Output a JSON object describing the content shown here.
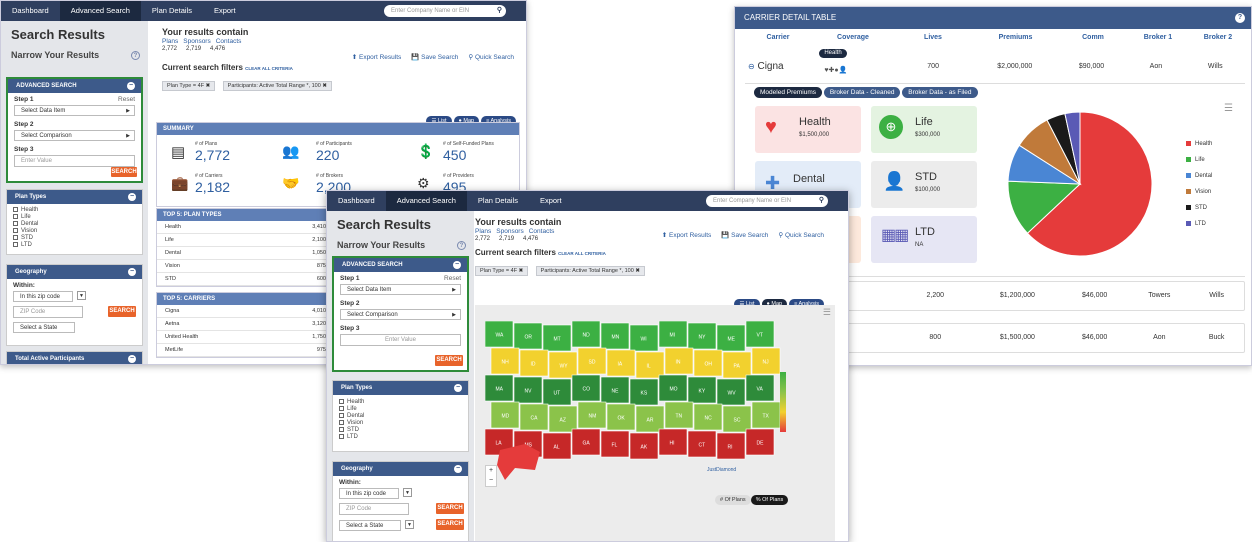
{
  "nav": {
    "items": [
      "Dashboard",
      "Advanced Search",
      "Plan Details",
      "Export"
    ],
    "search_placeholder": "Enter Company Name or EIN"
  },
  "sidebar": {
    "title": "Search Results",
    "narrow": "Narrow Your Results",
    "help": "?",
    "advanced": {
      "title": "ADVANCED SEARCH",
      "step1": "Step 1",
      "reset": "Reset",
      "select_data": "Select Data Item",
      "step2": "Step 2",
      "select_comparison": "Select Comparison",
      "step3": "Step 3",
      "enter_value": "Enter Value",
      "search": "SEARCH"
    },
    "plan_types": {
      "title": "Plan Types",
      "items": [
        "Health",
        "Life",
        "Dental",
        "Vision",
        "STD",
        "LTD"
      ]
    },
    "geography": {
      "title": "Geography",
      "within": "Within:",
      "zip_mode": "In this zip code",
      "zip_placeholder": "ZIP Code",
      "state_placeholder": "Select a State",
      "search": "SEARCH"
    },
    "total_active": "Total Active Participants"
  },
  "results": {
    "heading": "Your results contain",
    "labels": [
      "Plans",
      "Sponsors",
      "Contacts"
    ],
    "values": [
      "2,772",
      "2,719",
      "4,476"
    ],
    "export": "Export Results",
    "save": "Save Search",
    "quick": "Quick Search",
    "filters_title": "Current search filters",
    "clear": "CLEAR ALL CRITERIA",
    "filter1": "Plan Type = 4F",
    "filter2": "Participants: Active Total Range *, 100",
    "filter_x": "✖",
    "views": [
      "List",
      "Map",
      "Analysis"
    ]
  },
  "summary": {
    "title": "SUMMARY",
    "stats": [
      {
        "label": "# of Plans",
        "value": "2,772"
      },
      {
        "label": "# of Participants",
        "value": "220"
      },
      {
        "label": "# of Self-Funded Plans",
        "value": "450"
      },
      {
        "label": "# of Carriers",
        "value": "2,182"
      },
      {
        "label": "# of Brokers",
        "value": "2,200"
      },
      {
        "label": "# of Providers",
        "value": "495"
      }
    ]
  },
  "top_plan_types": {
    "title": "TOP 5: PLAN TYPES",
    "rows": [
      [
        "Health",
        "3,410"
      ],
      [
        "Life",
        "2,100"
      ],
      [
        "Dental",
        "1,050"
      ],
      [
        "Vision",
        "875"
      ],
      [
        "STD",
        "600"
      ]
    ]
  },
  "top_carriers": {
    "title": "TOP 5: CARRIERS",
    "rows": [
      [
        "Cigna",
        "4,010"
      ],
      [
        "Aetna",
        "3,120"
      ],
      [
        "United Health",
        "1,750"
      ],
      [
        "MetLife",
        "975"
      ]
    ]
  },
  "map": {
    "states": [
      "WA",
      "OR",
      "MT",
      "ND",
      "MN",
      "WI",
      "MI",
      "NY",
      "ME",
      "VT",
      "NH",
      "ID",
      "WY",
      "SD",
      "IA",
      "IL",
      "IN",
      "OH",
      "PA",
      "NJ",
      "MA",
      "NV",
      "UT",
      "CO",
      "NE",
      "KS",
      "MO",
      "KY",
      "WV",
      "VA",
      "MD",
      "CA",
      "AZ",
      "NM",
      "OK",
      "AR",
      "TN",
      "NC",
      "SC",
      "TX",
      "LA",
      "MS",
      "AL",
      "GA",
      "FL",
      "AK",
      "HI",
      "CT",
      "RI",
      "DE"
    ],
    "zoom_in": "+",
    "zoom_out": "−",
    "toggle": [
      "# Of Plans",
      "% Of Plans"
    ],
    "logo": "JustDiamond"
  },
  "carrier_table": {
    "title": "CARRIER DETAIL TABLE",
    "help": "?",
    "columns": [
      "Carrier",
      "Coverage",
      "Lives",
      "Premiums",
      "Comm",
      "Broker 1",
      "Broker 2"
    ],
    "row1": {
      "carrier": "Cigna",
      "tooltip": "Health",
      "lives": "700",
      "premiums": "$2,000,000",
      "comm": "$90,000",
      "broker1": "Aon",
      "broker2": "Wills"
    },
    "tabs": [
      "Modeled Premiums",
      "Broker Data - Cleaned",
      "Broker Data - as Filed"
    ],
    "tiles": [
      {
        "name": "Health",
        "value": "$1,500,000"
      },
      {
        "name": "Life",
        "value": "$300,000"
      },
      {
        "name": "Dental",
        "value": ""
      },
      {
        "name": "STD",
        "value": "$100,000"
      },
      {
        "name": "LTD",
        "value": "NA"
      }
    ],
    "rows": [
      {
        "lives": "2,200",
        "premiums": "$1,200,000",
        "comm": "$46,000",
        "broker1": "Towers",
        "broker2": "Wills"
      },
      {
        "lives": "800",
        "premiums": "$1,500,000",
        "comm": "$46,000",
        "broker1": "Aon",
        "broker2": "Buck"
      }
    ],
    "legend": [
      "Health",
      "Life",
      "Dental",
      "Vision",
      "STD",
      "LTD"
    ],
    "colors": {
      "Health": "#e53b3b",
      "Life": "#3cb043",
      "Dental": "#4a86d4",
      "Vision": "#c07a3a",
      "STD": "#1a1a1a",
      "LTD": "#5a5ab5"
    },
    "pie": [
      {
        "name": "Health",
        "value": 1500000
      },
      {
        "name": "Life",
        "value": 300000
      },
      {
        "name": "Dental",
        "value": 200000
      },
      {
        "name": "Vision",
        "value": 200000
      },
      {
        "name": "STD",
        "value": 100000
      },
      {
        "name": "LTD",
        "value": 80000
      }
    ]
  }
}
